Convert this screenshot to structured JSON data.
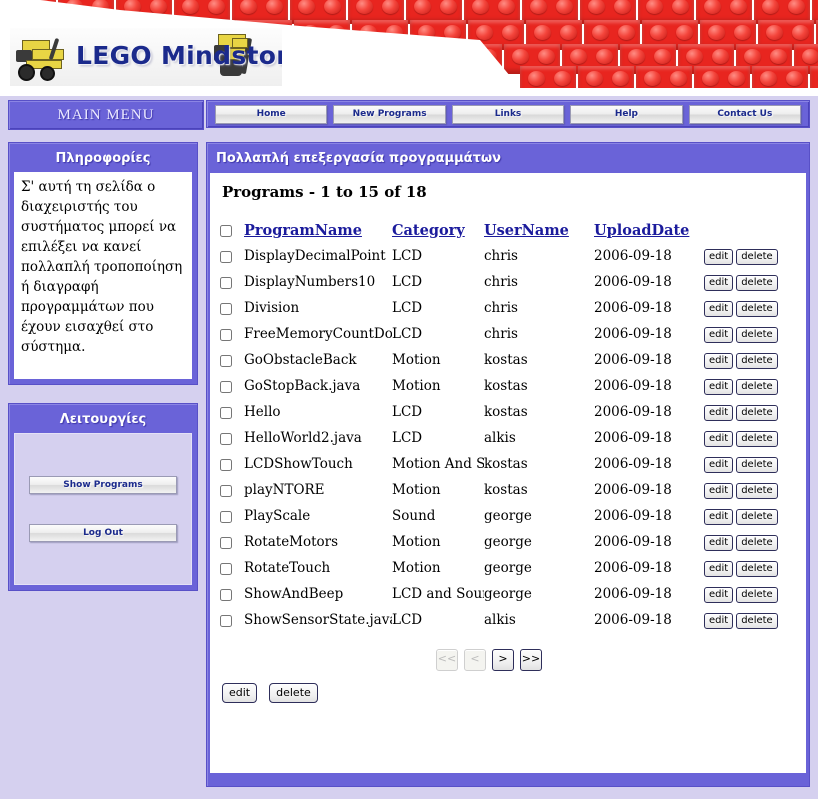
{
  "banner": {
    "logo_text": "LEGO Mindstorms",
    "alt": "lego-mindstorms-banner"
  },
  "menubar": {
    "main_menu_label": "MAIN MENU",
    "nav_items": [
      {
        "label": "Home",
        "name": "nav-home"
      },
      {
        "label": "New Programs",
        "name": "nav-new-programs"
      },
      {
        "label": "Links",
        "name": "nav-links"
      },
      {
        "label": "Help",
        "name": "nav-help"
      },
      {
        "label": "Contact Us",
        "name": "nav-contact-us"
      }
    ]
  },
  "sidebar": {
    "info_panel": {
      "title": "Πληροφορίες",
      "text": "Σ' αυτή τη σελίδα ο διαχειριστής του συστήματος μπορεί να επιλέξει να κανεί πολλαπλή τροποποίηση ή διαγραφή προγραμμάτων που έχουν εισαχθεί στο σύστημα."
    },
    "functions_panel": {
      "title": "Λειτουργίες",
      "buttons": [
        {
          "label": "Show Programs",
          "name": "show-programs-button"
        },
        {
          "label": "Log Out",
          "name": "log-out-button"
        }
      ]
    }
  },
  "content": {
    "title": "Πολλαπλή επεξεργασία προγραμμάτων",
    "heading": "Programs - 1 to 15 of 18",
    "columns": [
      {
        "label": "ProgramName",
        "key": "program_name"
      },
      {
        "label": "Category",
        "key": "category"
      },
      {
        "label": "UserName",
        "key": "user_name"
      },
      {
        "label": "UploadDate",
        "key": "upload_date"
      }
    ],
    "row_actions": {
      "edit": "edit",
      "delete": "delete"
    },
    "rows": [
      {
        "program_name": "DisplayDecimalPoint",
        "category": "LCD",
        "user_name": "chris",
        "upload_date": "2006-09-18"
      },
      {
        "program_name": "DisplayNumbers10",
        "category": "LCD",
        "user_name": "chris",
        "upload_date": "2006-09-18"
      },
      {
        "program_name": "Division",
        "category": "LCD",
        "user_name": "chris",
        "upload_date": "2006-09-18"
      },
      {
        "program_name": "FreeMemoryCountDown",
        "category": "LCD",
        "user_name": "chris",
        "upload_date": "2006-09-18"
      },
      {
        "program_name": "GoObstacleBack",
        "category": "Motion",
        "user_name": "kostas",
        "upload_date": "2006-09-18"
      },
      {
        "program_name": "GoStopBack.java",
        "category": "Motion",
        "user_name": "kostas",
        "upload_date": "2006-09-18"
      },
      {
        "program_name": "Hello",
        "category": "LCD",
        "user_name": "kostas",
        "upload_date": "2006-09-18"
      },
      {
        "program_name": "HelloWorld2.java",
        "category": "LCD",
        "user_name": "alkis",
        "upload_date": "2006-09-18"
      },
      {
        "program_name": "LCDShowTouch",
        "category": "Motion And Sound",
        "user_name": "kostas",
        "upload_date": "2006-09-18"
      },
      {
        "program_name": "playNTORE",
        "category": "Motion",
        "user_name": "kostas",
        "upload_date": "2006-09-18"
      },
      {
        "program_name": "PlayScale",
        "category": "Sound",
        "user_name": "george",
        "upload_date": "2006-09-18"
      },
      {
        "program_name": "RotateMotors",
        "category": "Motion",
        "user_name": "george",
        "upload_date": "2006-09-18"
      },
      {
        "program_name": "RotateTouch",
        "category": "Motion",
        "user_name": "george",
        "upload_date": "2006-09-18"
      },
      {
        "program_name": "ShowAndBeep",
        "category": "LCD and Sound",
        "user_name": "george",
        "upload_date": "2006-09-18"
      },
      {
        "program_name": "ShowSensorState.java",
        "category": "LCD",
        "user_name": "alkis",
        "upload_date": "2006-09-18"
      }
    ],
    "pager": [
      {
        "label": "<<",
        "name": "pager-first",
        "state": "disabled"
      },
      {
        "label": "<",
        "name": "pager-prev",
        "state": "disabled"
      },
      {
        "label": ">",
        "name": "pager-next",
        "state": "enabled"
      },
      {
        "label": ">>",
        "name": "pager-last",
        "state": "enabled"
      }
    ],
    "bottom_actions": [
      {
        "label": "edit",
        "name": "bulk-edit-button"
      },
      {
        "label": "delete",
        "name": "bulk-delete-button"
      }
    ]
  },
  "colors": {
    "purple": "#6a63d8",
    "page_background": "#d5d0ef",
    "link_blue": "#1b1b9c",
    "brick_red": "#e8251f",
    "logo_navy": "#1b2a8c"
  }
}
